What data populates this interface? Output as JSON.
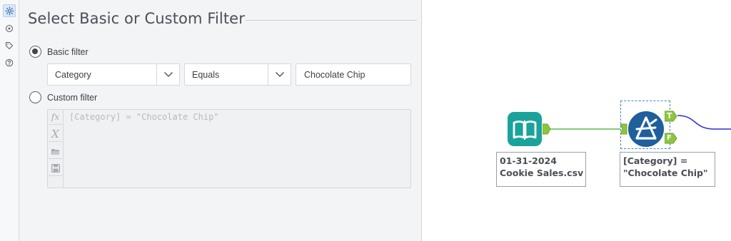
{
  "rail": {
    "icons": [
      "gear-icon",
      "annotation-icon",
      "tag-icon",
      "help-icon"
    ]
  },
  "panel": {
    "title": "Select Basic or Custom Filter",
    "basic_filter": {
      "label": "Basic filter",
      "checked": true,
      "field": "Category",
      "operator": "Equals",
      "value": "Chocolate Chip"
    },
    "custom_filter": {
      "label": "Custom filter",
      "checked": false,
      "expression": "[Category] = \"Chocolate Chip\"",
      "tools": [
        "fx-icon",
        "variable-icon",
        "open-folder-icon",
        "save-icon"
      ]
    }
  },
  "canvas": {
    "input_tool": {
      "label": "01-31-2024\nCookie Sales.csv"
    },
    "filter_tool": {
      "label": "[Category] =\n\"Chocolate Chip\"",
      "true_anchor": "T",
      "false_anchor": "F"
    },
    "colors": {
      "input_tool": "#1aa39a",
      "filter_tool": "#1e5f9c",
      "anchor": "#8cc63f",
      "connection_in": "#5fb84a",
      "connection_out": "#2a2fd0"
    }
  }
}
